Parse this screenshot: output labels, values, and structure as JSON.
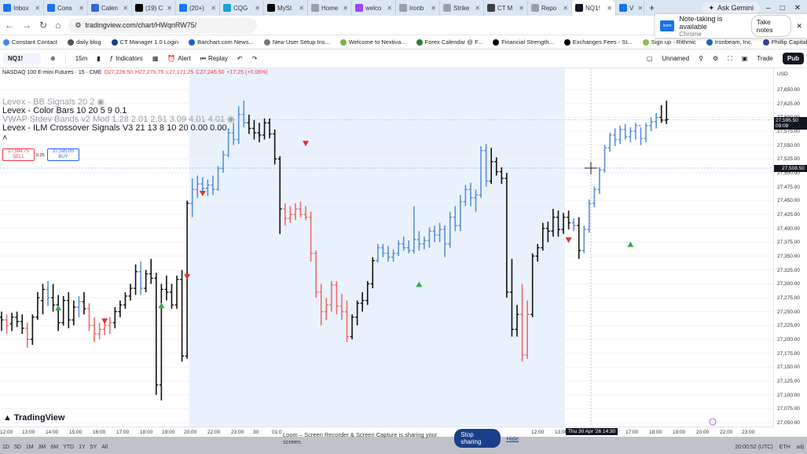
{
  "browser": {
    "tabs": [
      {
        "label": "Inbox",
        "color": "#1a73e8"
      },
      {
        "label": "Cons",
        "color": "#1a73e8"
      },
      {
        "label": "Calen",
        "color": "#3367d6"
      },
      {
        "label": "(19) C",
        "color": "#000000"
      },
      {
        "label": "(20+)",
        "color": "#1877f2"
      },
      {
        "label": "CQG",
        "color": "#1aa3d9"
      },
      {
        "label": "MySt",
        "color": "#000000"
      },
      {
        "label": "Home",
        "color": "#9aa0a6"
      },
      {
        "label": "welco",
        "color": "#a142f4"
      },
      {
        "label": "Ironb",
        "color": "#9aa0a6"
      },
      {
        "label": "Strike",
        "color": "#9aa0a6"
      },
      {
        "label": "CT M",
        "color": "#3c4043"
      },
      {
        "label": "Repo",
        "color": "#9aa0a6"
      },
      {
        "label": "NQ1!",
        "color": "#131722",
        "active": true
      },
      {
        "label": "V",
        "color": "#1a73e8"
      }
    ],
    "new_tab": "+",
    "gemini": "Ask Gemini",
    "url": "tradingview.com/chart/HWqnRW75/",
    "bookmarks": [
      "Constant Contact",
      "daily blog",
      "CT Manager 1.0 Login",
      "Barchart.com News...",
      "New User Setup Ins...",
      "Welcome to Nextiva...",
      "Forex Calendar @ F...",
      "Financial Strength...",
      "Exchanges Fees - St...",
      "Sign up - Rithmic",
      "Ironbeam, Inc.",
      "Phillip Capital - Login"
    ],
    "popup": {
      "title": "Note-taking is available",
      "sub": "Chrome",
      "button": "Take notes",
      "logo": "loom"
    }
  },
  "toolbar": {
    "symbol": "NQ1!",
    "interval": "15m",
    "indicators": "Indicators",
    "alert": "Alert",
    "replay": "Replay",
    "layout": "Unnamed",
    "trade": "Trade",
    "publish": "Pub"
  },
  "legend": {
    "title": "NASDAQ 100 E-mini Futures · 15 · CME",
    "o": "O27,228.50",
    "h": "H27,275.75",
    "l": "L27,171.25",
    "c": "C27,245.50",
    "chg": "+17.25 (+0.06%)",
    "sell_price": "27,594.75",
    "sell": "SELL",
    "spread": "0.25",
    "buy_price": "27,595.00",
    "buy": "BUY",
    "indicators": [
      "Levex - BB Signals 20 2",
      "Levex - Color Bars 10 20 5 9 0.1",
      "VWAP Stdev Bands v2 Mod 1.28 2.01 2.51 3.09 4.01 4.01",
      "Levex - ILM Crossover Signals V3 21 13 8 10 20  0.00  0.00"
    ]
  },
  "price_scale": {
    "currency": "USD",
    "ticks": [
      "27,650.00",
      "27,625.00",
      "27,600.00",
      "27,575.00",
      "27,550.00",
      "27,525.00",
      "27,500.00",
      "27,475.00",
      "27,450.00",
      "27,425.00",
      "27,400.00",
      "27,375.00",
      "27,350.00",
      "27,325.00",
      "27,300.00",
      "27,275.00",
      "27,250.00",
      "27,225.00",
      "27,200.00",
      "27,175.00",
      "27,150.00",
      "27,125.00",
      "27,100.00",
      "27,075.00",
      "27,050.00"
    ],
    "last_price": "27,595.50",
    "countdown": "09:08",
    "cursor_price": "27,508.50"
  },
  "time_scale": {
    "ticks": [
      "12:00",
      "13:00",
      "14:00",
      "15:00",
      "16:00",
      "17:00",
      "18:00",
      "19:00",
      "20:00",
      "22:00",
      "23:00",
      "30",
      "01:0",
      "12:00",
      "13:00",
      "14:30",
      "16:00",
      "17:00",
      "18:00",
      "19:00",
      "20:00",
      "22:00",
      "23:00"
    ],
    "cursor_time": "Thu 30 Apr '26  14:30"
  },
  "ranges": [
    "1D",
    "5D",
    "1M",
    "3M",
    "6M",
    "YTD",
    "1Y",
    "5Y",
    "All"
  ],
  "status": {
    "clock": "20:00:52 (UTC)",
    "session": "ETH",
    "adj": "adj"
  },
  "loom": {
    "message": "Loom – Screen Recorder & Screen Capture is sharing your screen.",
    "stop": "Stop sharing",
    "hide": "Hide"
  },
  "brand": "TradingView",
  "colors": {
    "bull": "#5b8fd9",
    "bear": "#ef6b6b",
    "neutral": "#111111",
    "signal_up": "#3aa655",
    "signal_down": "#e03030",
    "shade": "#e9f2fc"
  }
}
